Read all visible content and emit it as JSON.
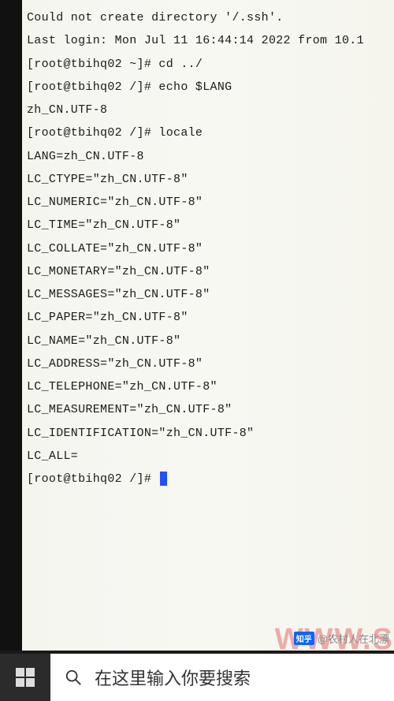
{
  "terminal": {
    "lines": [
      "Could not create directory '/.ssh'.",
      "Last login: Mon Jul 11 16:44:14 2022 from 10.1",
      "[root@tbihq02 ~]#  cd ../",
      "[root@tbihq02 /]# echo $LANG",
      "zh_CN.UTF-8",
      "[root@tbihq02 /]# locale",
      "LANG=zh_CN.UTF-8",
      "LC_CTYPE=\"zh_CN.UTF-8\"",
      "LC_NUMERIC=\"zh_CN.UTF-8\"",
      "LC_TIME=\"zh_CN.UTF-8\"",
      "LC_COLLATE=\"zh_CN.UTF-8\"",
      "LC_MONETARY=\"zh_CN.UTF-8\"",
      "LC_MESSAGES=\"zh_CN.UTF-8\"",
      "LC_PAPER=\"zh_CN.UTF-8\"",
      "LC_NAME=\"zh_CN.UTF-8\"",
      "LC_ADDRESS=\"zh_CN.UTF-8\"",
      "LC_TELEPHONE=\"zh_CN.UTF-8\"",
      "LC_MEASUREMENT=\"zh_CN.UTF-8\"",
      "LC_IDENTIFICATION=\"zh_CN.UTF-8\"",
      "LC_ALL="
    ],
    "prompt": "[root@tbihq02 /]# "
  },
  "taskbar": {
    "search_placeholder": "在这里输入你要搜索"
  },
  "watermark": {
    "attribution_prefix": "知乎",
    "attribution_user": "@农村人在北漂",
    "big_text": "WWW.S"
  }
}
